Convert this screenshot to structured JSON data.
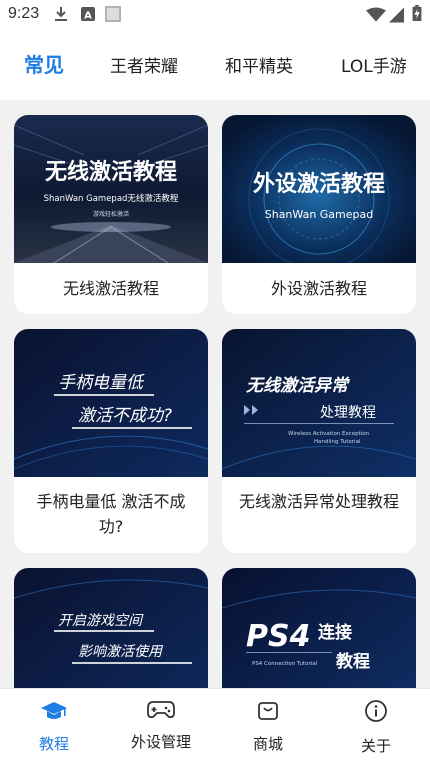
{
  "status_bar": {
    "time": "9:23",
    "icons": [
      "download-icon",
      "a-box-icon",
      "image-icon",
      "wifi-icon",
      "signal-icon",
      "battery-charging-icon"
    ]
  },
  "tabs": [
    {
      "label": "常见",
      "active": true
    },
    {
      "label": "王者荣耀",
      "active": false
    },
    {
      "label": "和平精英",
      "active": false
    },
    {
      "label": "LOL手游",
      "active": false
    }
  ],
  "cards": [
    {
      "title": "无线激活教程",
      "thumb_heading": "无线激活教程",
      "thumb_sub": "ShanWan Gamepad无线激活教程",
      "thumb_small": "游戏轻松激活"
    },
    {
      "title": "外设激活教程",
      "thumb_heading": "外设激活教程",
      "thumb_sub": "ShanWan Gamepad"
    },
    {
      "title": "手柄电量低 激活不成功?",
      "thumb_line1": "手柄电量低",
      "thumb_line2": "激活不成功?"
    },
    {
      "title": "无线激活异常处理教程",
      "thumb_heading": "无线激活异常",
      "thumb_line2": "处理教程",
      "thumb_en1": "Wireless Activation Exception",
      "thumb_en2": "Handling Tutorial"
    },
    {
      "title": "",
      "thumb_line1": "开启游戏空间",
      "thumb_line2": "影响激活使用"
    },
    {
      "title": "",
      "thumb_heading": "PS4",
      "thumb_line1": "连接",
      "thumb_line2": "教程",
      "thumb_en1": "PS4 Connection Tutorial"
    }
  ],
  "bottom_nav": [
    {
      "label": "教程",
      "icon": "graduation-cap-icon",
      "active": true
    },
    {
      "label": "外设管理",
      "icon": "gamepad-icon",
      "active": false
    },
    {
      "label": "商城",
      "icon": "shopping-bag-icon",
      "active": false
    },
    {
      "label": "关于",
      "icon": "info-icon",
      "active": false
    }
  ],
  "colors": {
    "accent": "#1f7de6",
    "background": "#f1f1f1",
    "card": "#ffffff",
    "thumb_dark": "#0a1a3a"
  }
}
